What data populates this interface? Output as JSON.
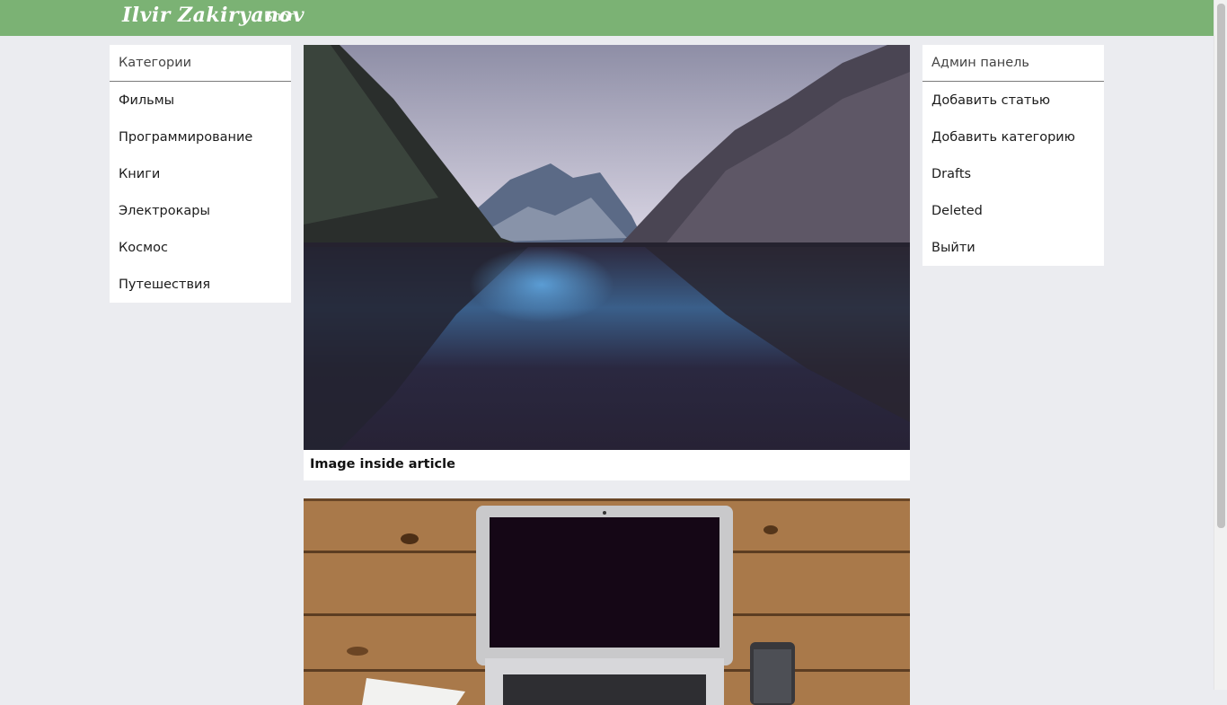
{
  "navbar": {
    "brand": "Ilvir Zakiryanov",
    "links": [
      "Блог"
    ]
  },
  "categories": {
    "title": "Категории",
    "items": [
      "Фильмы",
      "Программирование",
      "Книги",
      "Электрокары",
      "Космос",
      "Путешествия"
    ]
  },
  "admin": {
    "title": "Админ панель",
    "items": [
      "Добавить статью",
      "Добавить категорию",
      "Drafts",
      "Deleted",
      "Выйти"
    ]
  },
  "articles": [
    {
      "title": "Image inside article",
      "image": "mountain-lake-photo"
    },
    {
      "title": "",
      "image": "laptop-on-desk-photo"
    }
  ],
  "colors": {
    "navbar": "#7bb274",
    "background": "#ebecf0"
  }
}
